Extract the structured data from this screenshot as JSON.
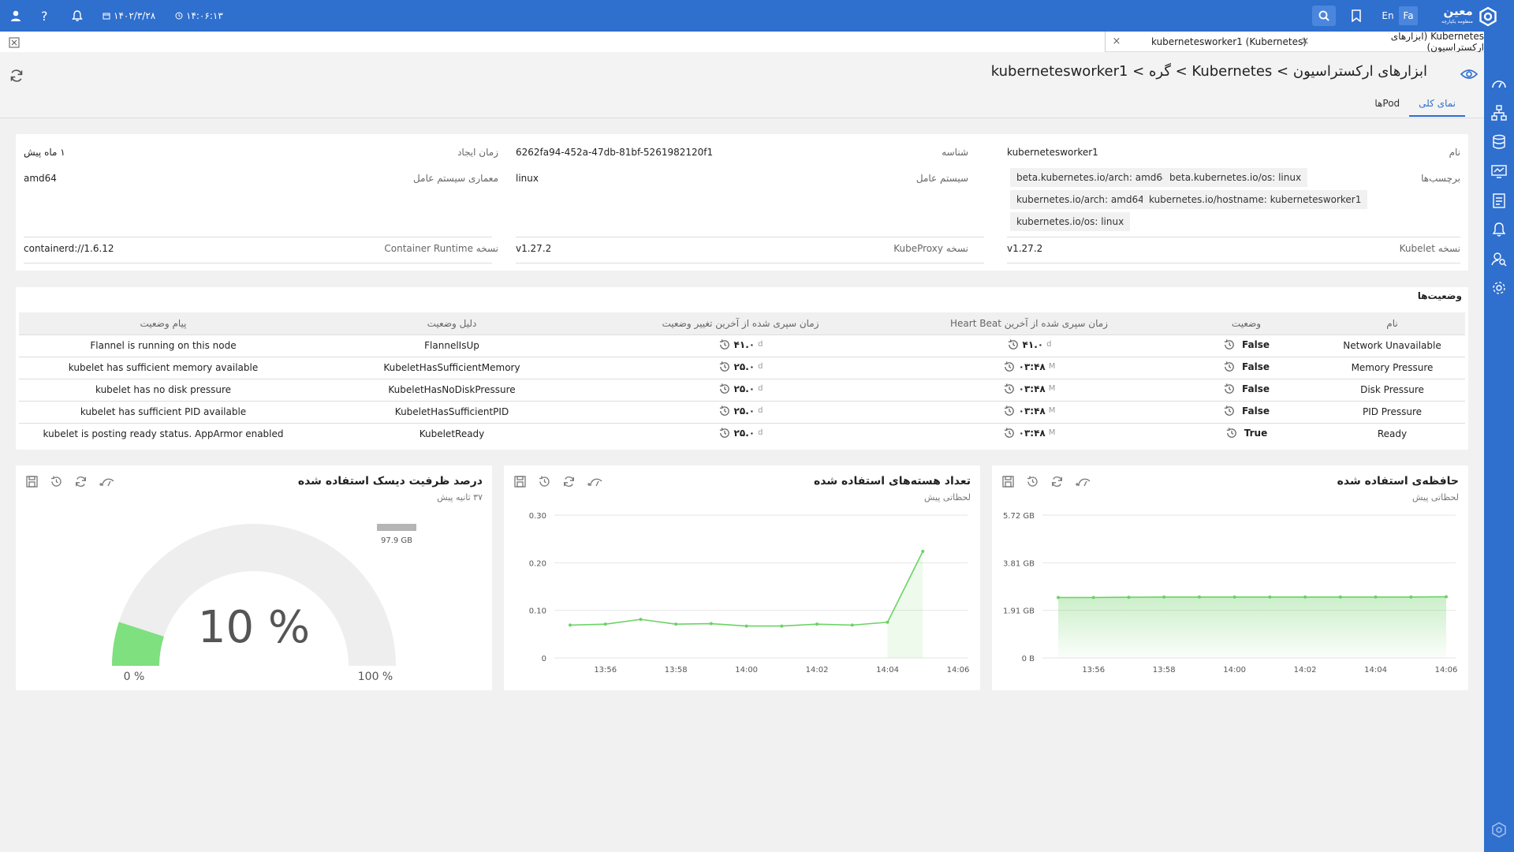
{
  "topbar": {
    "time": "۱۴:۰۶:۱۳",
    "date": "۱۴۰۲/۳/۲۸",
    "lang_en": "En",
    "lang_fa": "Fa",
    "logo_text": "معین",
    "logo_sub": "منظومه یکپارچه",
    "color": "#2f6fce"
  },
  "tabs": [
    {
      "label": "Kubernetes (ابزارهای ارکستراسیون)"
    },
    {
      "label": "(Kubernetes) kubernetesworker1"
    }
  ],
  "header": {
    "breadcrumb": "ابزارهای ارکستراسیون > Kubernetes > گره > kubernetesworker1",
    "tab_overview": "نمای کلی",
    "tab_pods": "Podها"
  },
  "info": {
    "name_label": "نام",
    "name_value": "kubernetesworker1",
    "id_label": "شناسه",
    "id_value": "6262fa94-452a-47db-81bf-5261982120f1",
    "created_label": "زمان ایجاد",
    "created_value": "۱ ماه پیش",
    "labels_label": "برچسب‌ها",
    "labels": [
      "beta.kubernetes.io/arch: amd64",
      "beta.kubernetes.io/os: linux",
      "kubernetes.io/arch: amd64",
      "kubernetes.io/hostname: kubernetesworker1",
      "kubernetes.io/os: linux"
    ],
    "os_label": "سیستم عامل",
    "os_value": "linux",
    "arch_label": "معماری سیستم عامل",
    "arch_value": "amd64",
    "kubelet_label": "نسخه Kubelet",
    "kubelet_value": "v1.27.2",
    "kubeproxy_label": "نسخه KubeProxy",
    "kubeproxy_value": "v1.27.2",
    "runtime_label": "نسخه Container Runtime",
    "runtime_value": "containerd://1.6.12"
  },
  "conditions": {
    "title": "وضعیت‌ها",
    "headers": [
      "نام",
      "وضعیت",
      "زمان سپری شده از آخرین Heart Beat",
      "زمان سپری شده از آخرین تغییر وضعیت",
      "دلیل وضعیت",
      "پیام وضعیت"
    ],
    "rows": [
      {
        "name": "Network Unavailable",
        "status": "False",
        "hb": "۴۱.۰",
        "hb_unit": "d",
        "tr": "۴۱.۰",
        "tr_unit": "d",
        "reason": "FlannelIsUp",
        "message": "Flannel is running on this node"
      },
      {
        "name": "Memory Pressure",
        "status": "False",
        "hb": "۰۳:۴۸",
        "hb_unit": "M",
        "tr": "۲۵.۰",
        "tr_unit": "d",
        "reason": "KubeletHasSufficientMemory",
        "message": "kubelet has sufficient memory available"
      },
      {
        "name": "Disk Pressure",
        "status": "False",
        "hb": "۰۳:۴۸",
        "hb_unit": "M",
        "tr": "۲۵.۰",
        "tr_unit": "d",
        "reason": "KubeletHasNoDiskPressure",
        "message": "kubelet has no disk pressure"
      },
      {
        "name": "PID Pressure",
        "status": "False",
        "hb": "۰۳:۴۸",
        "hb_unit": "M",
        "tr": "۲۵.۰",
        "tr_unit": "d",
        "reason": "KubeletHasSufficientPID",
        "message": "kubelet has sufficient PID available"
      },
      {
        "name": "Ready",
        "status": "True",
        "hb": "۰۳:۴۸",
        "hb_unit": "M",
        "tr": "۲۵.۰",
        "tr_unit": "d",
        "reason": "KubeletReady",
        "message": "kubelet is posting ready status. AppArmor enabled"
      }
    ]
  },
  "panels": {
    "memory": {
      "title": "حافظه‌ی استفاده شده",
      "subtitle": "لحظاتی پیش"
    },
    "cores": {
      "title": "تعداد هسته‌های استفاده شده",
      "subtitle": "لحظاتی پیش"
    },
    "disk": {
      "title": "درصد ظرفیت دیسک استفاده شده",
      "subtitle": "۳۷ ثانیه پیش"
    }
  },
  "chart_data": [
    {
      "type": "area",
      "y_tick_labels": [
        "0 B",
        "1.91 GB",
        "3.81 GB",
        "5.72 GB"
      ],
      "x_tick_labels": [
        "13:56",
        "13:58",
        "14:00",
        "14:02",
        "14:04",
        "14:06"
      ],
      "ylim": [
        0,
        5.72
      ],
      "x": [
        "13:55",
        "13:56",
        "13:57",
        "13:58",
        "13:59",
        "14:00",
        "14:01",
        "14:02",
        "14:03",
        "14:04",
        "14:05",
        "14:06"
      ],
      "values": [
        2.42,
        2.42,
        2.43,
        2.44,
        2.44,
        2.44,
        2.44,
        2.44,
        2.44,
        2.44,
        2.44,
        2.45
      ],
      "color": "#6cd266"
    },
    {
      "type": "line",
      "y_tick_labels": [
        "0",
        "0.10",
        "0.20",
        "0.30"
      ],
      "x_tick_labels": [
        "13:56",
        "13:58",
        "14:00",
        "14:02",
        "14:04",
        "14:06"
      ],
      "ylim": [
        0,
        0.3
      ],
      "x": [
        "13:55",
        "13:56",
        "13:57",
        "13:58",
        "13:59",
        "14:00",
        "14:01",
        "14:02",
        "14:03",
        "14:04",
        "14:05"
      ],
      "values": [
        0.069,
        0.071,
        0.081,
        0.071,
        0.072,
        0.067,
        0.067,
        0.071,
        0.069,
        0.075,
        0.224
      ],
      "color": "#6cd266"
    },
    {
      "type": "gauge",
      "value": 10,
      "center_label": "10 %",
      "min_label": "0 %",
      "max_label": "100 %",
      "legend_label": "97.9 GB",
      "color": "#7ee07f"
    }
  ]
}
